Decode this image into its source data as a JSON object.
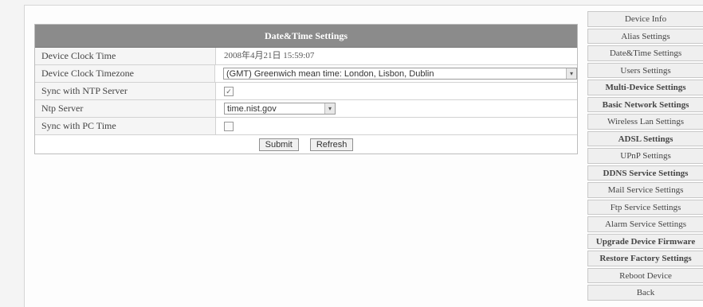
{
  "panel": {
    "title": "Date&Time Settings",
    "rows": {
      "clock_time": {
        "label": "Device Clock Time",
        "value": "2008年4月21日 15:59:07"
      },
      "timezone": {
        "label": "Device Clock Timezone",
        "value": "(GMT) Greenwich mean time: London, Lisbon, Dublin"
      },
      "ntp_sync": {
        "label": "Sync with NTP Server",
        "checked": true
      },
      "ntp_server": {
        "label": "Ntp Server",
        "value": "time.nist.gov"
      },
      "pc_sync": {
        "label": "Sync with PC Time",
        "checked": false
      }
    },
    "buttons": {
      "submit": "Submit",
      "refresh": "Refresh"
    }
  },
  "sidebar": {
    "items": [
      {
        "label": "Device Info"
      },
      {
        "label": "Alias Settings"
      },
      {
        "label": "Date&Time Settings"
      },
      {
        "label": "Users Settings"
      },
      {
        "label": "Multi-Device Settings"
      },
      {
        "label": "Basic Network Settings"
      },
      {
        "label": "Wireless Lan Settings"
      },
      {
        "label": "ADSL Settings"
      },
      {
        "label": "UPnP Settings"
      },
      {
        "label": "DDNS Service Settings"
      },
      {
        "label": "Mail Service Settings"
      },
      {
        "label": "Ftp Service Settings"
      },
      {
        "label": "Alarm Service Settings"
      },
      {
        "label": "Upgrade Device Firmware"
      },
      {
        "label": "Restore Factory Settings"
      },
      {
        "label": "Reboot Device"
      },
      {
        "label": "Back"
      }
    ]
  },
  "icons": {
    "check": "✓",
    "dropdown": "▾"
  }
}
